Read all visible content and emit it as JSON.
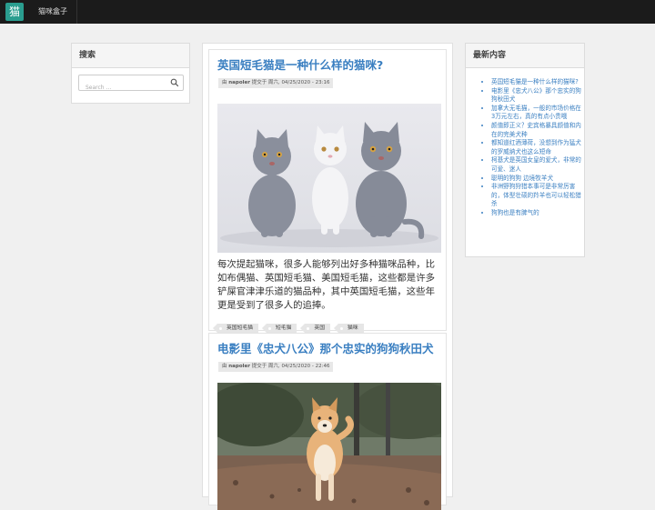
{
  "nav": {
    "logo_text": "猫",
    "brand": "猫咪盒子"
  },
  "sidebar_left": {
    "search_title": "搜索",
    "search_placeholder": "Search ..."
  },
  "posts": [
    {
      "title": "英国短毛猫是一种什么样的猫咪?",
      "meta_prefix": "由",
      "author": "napoler",
      "meta_mid": "提交于 周六,",
      "date": "04/25/2020 - 23:16",
      "image_alt": "three british shorthair kittens",
      "excerpt": "每次提起猫咪，很多人能够列出好多种猫咪品种，比如布偶猫、英国短毛猫、美国短毛猫，这些都是许多铲屎官津津乐道的猫品种，其中英国短毛猫，这些年更是受到了很多人的追捧。",
      "tags": [
        "英国短毛猫",
        "短毛猫",
        "英国",
        "猫咪"
      ]
    },
    {
      "title": "电影里《忠犬八公》那个忠实的狗狗秋田犬",
      "meta_prefix": "由",
      "author": "napoler",
      "meta_mid": "提交于 周六,",
      "date": "04/25/2020 - 22:46",
      "image_alt": "akita dog on a path"
    }
  ],
  "sidebar_right": {
    "title": "最新内容",
    "items": [
      "英国短毛猫是一种什么样的猫咪?",
      "电影里《忠犬八公》那个忠实的狗狗秋田犬",
      "加拿大无毛猫，一般的市场价格在3万元左右，真的有点小贵哦",
      "颜值即正义？史宾格暴具颜值和内在的完美犬种",
      "都知道红酒薄荷，没想到作为猛犬的罗威纳犬也这么短命",
      "柯基犬是英国女皇的爱犬，非常的可爱、迷人",
      "聪明的狗狗 边境牧羊犬",
      "非洲野狗狩猎本事可是非常厉害的，体型壮硕的羚羊也可以轻松猎杀",
      "狗狗也是有脾气的"
    ]
  }
}
